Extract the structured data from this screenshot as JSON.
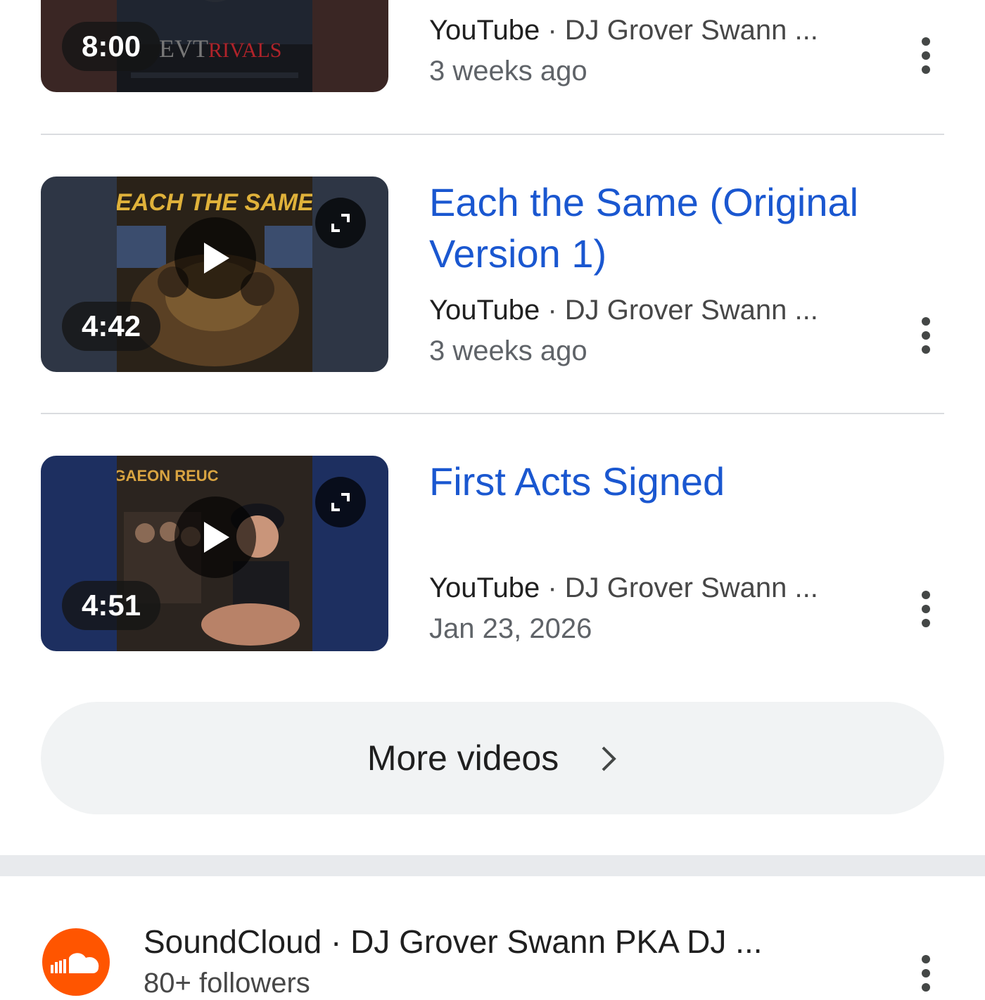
{
  "videos": [
    {
      "title": "",
      "source": "YouTube",
      "channel": "· DJ Grover Swann ...",
      "date": "3 weeks ago",
      "duration": "8:00",
      "poster_text": "EVT",
      "poster_accent": "RIVALS",
      "bg_color": "#3a2624"
    },
    {
      "title": "Each the Same (Original Version 1)",
      "source": "YouTube",
      "channel": "· DJ Grover Swann ...",
      "date": "3 weeks ago",
      "duration": "4:42",
      "poster_text": "EACH THE SAME",
      "bg_color": "#2e3645"
    },
    {
      "title": "First Acts Signed",
      "source": "YouTube",
      "channel": "· DJ Grover Swann ...",
      "date": "Jan 23, 2026",
      "duration": "4:51",
      "poster_text": "GAEON REUC",
      "bg_color": "#1d2f60"
    }
  ],
  "more_videos_label": "More videos",
  "soundcloud": {
    "title": "SoundCloud · DJ Grover Swann PKA DJ ...",
    "subtitle": "80+ followers",
    "brand_color": "#ff5500"
  },
  "colors": {
    "link": "#1a57d0",
    "divider": "#dadce0",
    "pill_bg": "#f1f3f4"
  }
}
